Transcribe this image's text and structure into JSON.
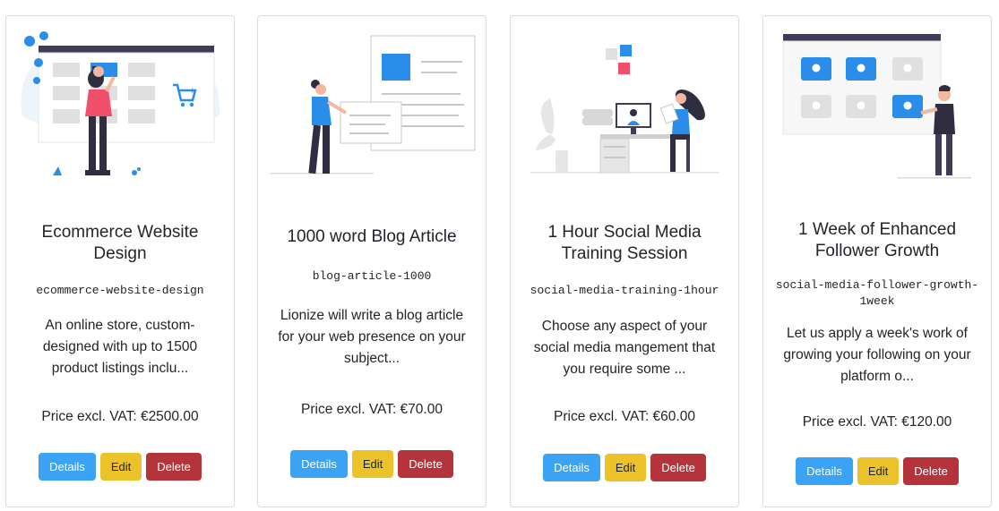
{
  "products": [
    {
      "title": "Ecommerce Website Design",
      "slug": "ecommerce-website-design",
      "description": "An online store, custom-designed with up to 1500 product listings inclu...",
      "price": "Price excl. VAT: €2500.00",
      "illustration": "ecommerce-illustration"
    },
    {
      "title": "1000 word Blog Article",
      "slug": "blog-article-1000",
      "description": "Lionize will write a blog article for your web presence on your subject...",
      "price": "Price excl. VAT: €70.00",
      "illustration": "blog-article-illustration"
    },
    {
      "title": "1 Hour Social Media Training Session",
      "slug": "social-media-training-1hour",
      "description": "Choose any aspect of your social media mangement that you require some ...",
      "price": "Price excl. VAT: €60.00",
      "illustration": "video-training-illustration"
    },
    {
      "title": "1 Week of Enhanced Follower Growth",
      "slug": "social-media-follower-growth-1week",
      "description": "Let us apply a week's work of growing your following on your platform o...",
      "price": "Price excl. VAT: €120.00",
      "illustration": "follower-growth-illustration"
    }
  ],
  "actions": {
    "details_label": "Details",
    "edit_label": "Edit",
    "delete_label": "Delete"
  },
  "colors": {
    "details": "#3aa3f5",
    "edit": "#ecc22b",
    "delete": "#b5343b",
    "accent_illustration": "#2a8de9"
  }
}
